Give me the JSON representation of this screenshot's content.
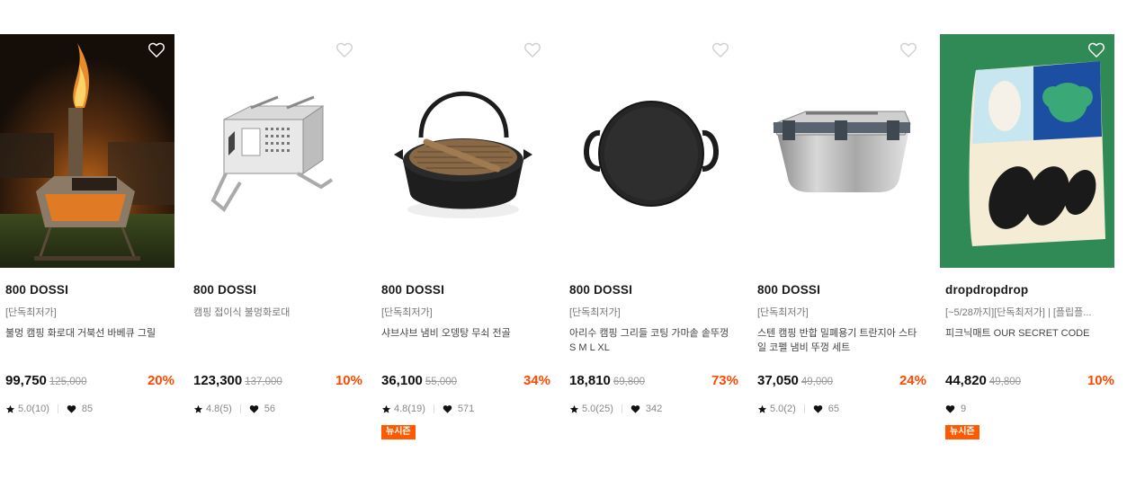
{
  "products": [
    {
      "brand": "800 DOSSI",
      "subtitle": "[단독최저가]",
      "name": "불멍 캠핑 화로대 거북선 바베큐 그릴",
      "price": "99,750",
      "original_price": "125,000",
      "discount": "20%",
      "rating": "5.0(10)",
      "likes": "85",
      "badge": ""
    },
    {
      "brand": "800 DOSSI",
      "subtitle": "캠핑 접이식 불멍화로대",
      "name": "",
      "price": "123,300",
      "original_price": "137,000",
      "discount": "10%",
      "rating": "4.8(5)",
      "likes": "56",
      "badge": ""
    },
    {
      "brand": "800 DOSSI",
      "subtitle": "[단독최저가]",
      "name": "샤브샤브 냄비 오뎅탕 무쇠 전골",
      "price": "36,100",
      "original_price": "55,000",
      "discount": "34%",
      "rating": "4.8(19)",
      "likes": "571",
      "badge": "뉴시즌"
    },
    {
      "brand": "800 DOSSI",
      "subtitle": "[단독최저가]",
      "name": "아리수 캠핑 그리들 코팅 가마솥 솥뚜껑 S M L XL",
      "price": "18,810",
      "original_price": "69,800",
      "discount": "73%",
      "rating": "5.0(25)",
      "likes": "342",
      "badge": ""
    },
    {
      "brand": "800 DOSSI",
      "subtitle": "[단독최저가]",
      "name": "스텐 캠핑 반합 밀폐용기 트란지아 스타일 코펠 냄비 뚜껑 세트",
      "price": "37,050",
      "original_price": "49,000",
      "discount": "24%",
      "rating": "5.0(2)",
      "likes": "65",
      "badge": ""
    },
    {
      "brand": "dropdropdrop",
      "subtitle": "[~5/28까지][단독최저가] | [플립플...",
      "name": "피크닉매트 OUR SECRET CODE",
      "price": "44,820",
      "original_price": "49,800",
      "discount": "10%",
      "rating": "",
      "likes": "9",
      "badge": "뉴시즌"
    }
  ]
}
